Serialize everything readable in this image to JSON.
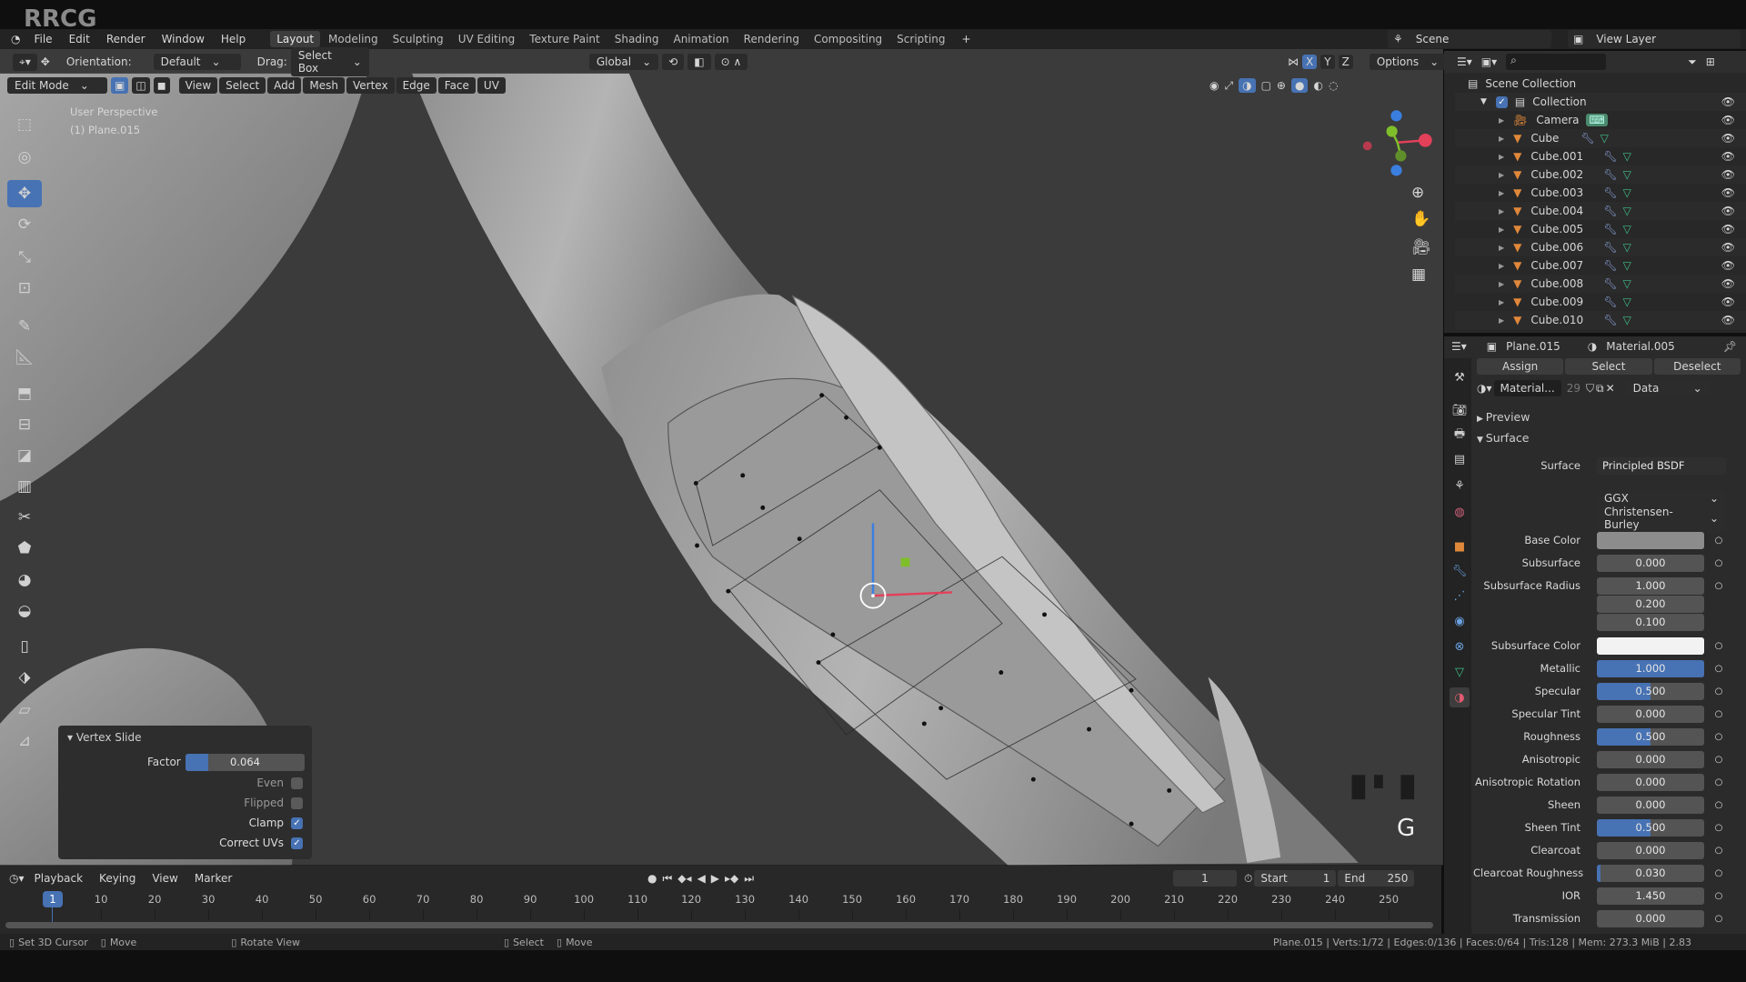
{
  "watermark": "RRCG",
  "menubar": {
    "items": [
      "File",
      "Edit",
      "Render",
      "Window",
      "Help"
    ],
    "workspaces": [
      "Layout",
      "Modeling",
      "Sculpting",
      "UV Editing",
      "Texture Paint",
      "Shading",
      "Animation",
      "Rendering",
      "Compositing",
      "Scripting"
    ],
    "active_workspace": "Layout",
    "add_tab": "+",
    "scene": "Scene",
    "view_layer": "View Layer"
  },
  "tool_header": {
    "orientation_label": "Orientation:",
    "orientation_value": "Default",
    "drag_label": "Drag:",
    "drag_value": "Select Box",
    "transform_orientation": "Global",
    "axis_x": "X",
    "axis_y": "Y",
    "axis_z": "Z",
    "options": "Options"
  },
  "edit_header": {
    "mode": "Edit Mode",
    "menus": [
      "View",
      "Select",
      "Add",
      "Mesh",
      "Vertex",
      "Edge",
      "Face",
      "UV"
    ]
  },
  "viewport": {
    "view_name": "User Perspective",
    "object_name": "(1) Plane.015",
    "key_hint": "G",
    "gizmo": {
      "x": "X",
      "y": "Y",
      "z": "Z"
    }
  },
  "toolbar_icons": [
    "select-box-icon",
    "cursor-icon",
    "move-icon",
    "rotate-icon",
    "scale-icon",
    "transform-icon",
    "annotate-icon",
    "measure-icon",
    "extrude-icon",
    "inset-icon",
    "bevel-icon",
    "loop-cut-icon",
    "knife-icon",
    "poly-build-icon",
    "spin-icon",
    "smooth-icon",
    "edge-slide-icon",
    "shrink-fatten-icon",
    "shear-icon",
    "rip-icon"
  ],
  "operator_panel": {
    "title": "Vertex Slide",
    "factor_label": "Factor",
    "factor_value": "0.064",
    "factor": 0.064,
    "options": [
      {
        "label": "Even",
        "checked": false
      },
      {
        "label": "Flipped",
        "checked": false
      },
      {
        "label": "Clamp",
        "checked": true
      },
      {
        "label": "Correct UVs",
        "checked": true
      }
    ]
  },
  "outliner": {
    "root": "Scene Collection",
    "collection": "Collection",
    "items": [
      "Camera",
      "Cube",
      "Cube.001",
      "Cube.002",
      "Cube.003",
      "Cube.004",
      "Cube.005",
      "Cube.006",
      "Cube.007",
      "Cube.008",
      "Cube.009",
      "Cube.010"
    ]
  },
  "properties": {
    "object": "Plane.015",
    "material": "Material.005",
    "assign": "Assign",
    "select": "Select",
    "deselect": "Deselect",
    "slot_name": "Material...",
    "users": "29",
    "link": "Data",
    "preview": "Preview",
    "surface_panel": "Surface",
    "surface_label": "Surface",
    "surface_value": "Principled BSDF",
    "distribution": "GGX",
    "subsurface_method": "Christensen-Burley",
    "rows": [
      {
        "label": "Base Color",
        "type": "color",
        "color": "#8c8c8c"
      },
      {
        "label": "Subsurface",
        "value": "0.000",
        "fill": 0
      },
      {
        "label": "Subsurface Radius",
        "value": "1.000",
        "fill": 0,
        "extra": [
          "0.200",
          "0.100"
        ]
      },
      {
        "label": "Subsurface Color",
        "type": "color",
        "color": "#f2f2f2"
      },
      {
        "label": "Metallic",
        "value": "1.000",
        "fill": 1
      },
      {
        "label": "Specular",
        "value": "0.500",
        "fill": 0.5
      },
      {
        "label": "Specular Tint",
        "value": "0.000",
        "fill": 0
      },
      {
        "label": "Roughness",
        "value": "0.500",
        "fill": 0.5
      },
      {
        "label": "Anisotropic",
        "value": "0.000",
        "fill": 0
      },
      {
        "label": "Anisotropic Rotation",
        "value": "0.000",
        "fill": 0
      },
      {
        "label": "Sheen",
        "value": "0.000",
        "fill": 0
      },
      {
        "label": "Sheen Tint",
        "value": "0.500",
        "fill": 0.5
      },
      {
        "label": "Clearcoat",
        "value": "0.000",
        "fill": 0
      },
      {
        "label": "Clearcoat Roughness",
        "value": "0.030",
        "fill": 0.03
      },
      {
        "label": "IOR",
        "value": "1.450",
        "fill": 0
      },
      {
        "label": "Transmission",
        "value": "0.000",
        "fill": 0
      }
    ]
  },
  "timeline": {
    "menus": [
      "Playback",
      "Keying",
      "View",
      "Marker"
    ],
    "current_frame": "1",
    "start_label": "Start",
    "start": "1",
    "end_label": "End",
    "end": "250",
    "ticks": [
      "10",
      "20",
      "30",
      "40",
      "50",
      "60",
      "70",
      "80",
      "90",
      "100",
      "110",
      "120",
      "130",
      "140",
      "150",
      "160",
      "170",
      "180",
      "190",
      "200",
      "210",
      "220",
      "230",
      "240",
      "250"
    ]
  },
  "statusbar": {
    "hints": [
      "Set 3D Cursor",
      "Move",
      "Rotate View",
      "Select",
      "Move"
    ],
    "stats": "Plane.015 | Verts:1/72 | Edges:0/136 | Faces:0/64 | Tris:128 | Mem: 273.3 MiB | 2.83"
  },
  "colors": {
    "accent": "#4772b3",
    "object_orange": "#e0883a",
    "mesh_green": "#3fbf8a",
    "x_axis": "#e3405a",
    "y_axis": "#7fbf2a",
    "z_axis": "#3a7fe0"
  }
}
